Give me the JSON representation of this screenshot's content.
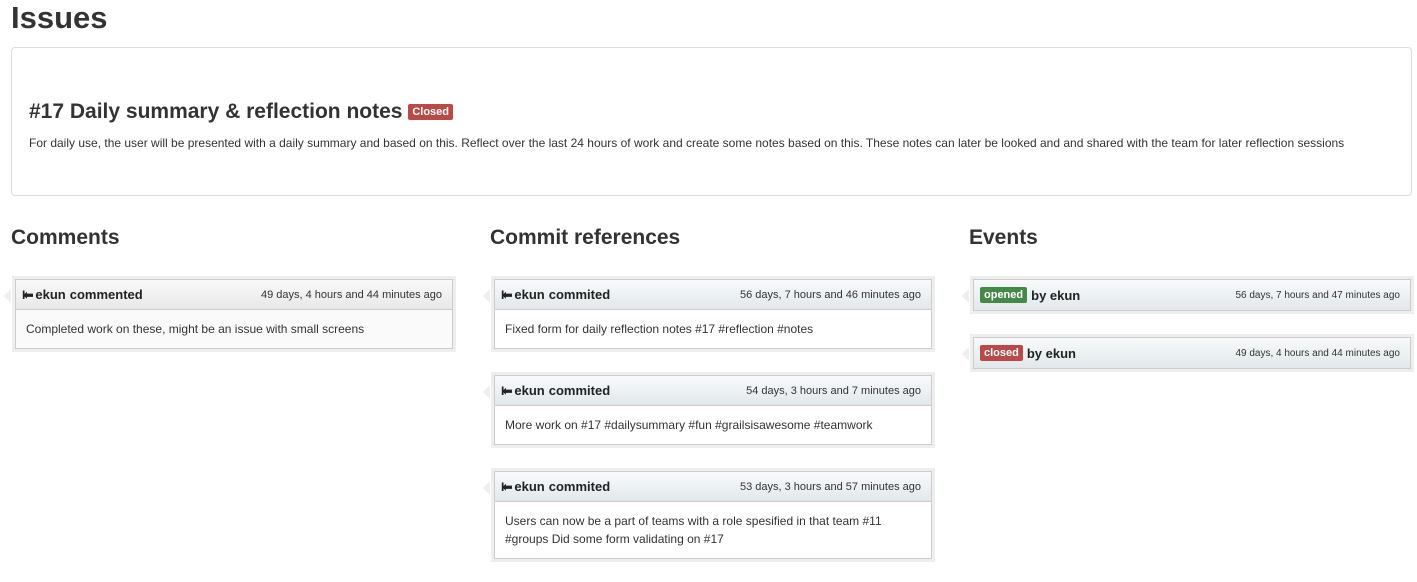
{
  "page": {
    "title": "Issues"
  },
  "issue": {
    "title": "#17 Daily summary & reflection notes",
    "status": "Closed",
    "description": "For daily use, the user will be presented with a daily summary and based on this. Reflect over the last 24 hours of work and create some notes based on this. These notes can later be looked and and shared with the team for later reflection sessions"
  },
  "comments": {
    "heading": "Comments",
    "items": [
      {
        "author": "ekun",
        "action": "commented",
        "time": "49 days, 4 hours and 44 minutes ago",
        "text": "Completed work on these, might be an issue with small screens"
      }
    ]
  },
  "commits": {
    "heading": "Commit references",
    "items": [
      {
        "author": "ekun",
        "action": "commited",
        "time": "56 days, 7 hours and 46 minutes ago",
        "text": "Fixed form for daily reflection notes #17 #reflection #notes"
      },
      {
        "author": "ekun",
        "action": "commited",
        "time": "54 days, 3 hours and 7 minutes ago",
        "text": "More work on #17 #dailysummary #fun #grailsisawesome #teamwork"
      },
      {
        "author": "ekun",
        "action": "commited",
        "time": "53 days, 3 hours and 57 minutes ago",
        "text": "Users can now be a part of teams with a role spesified in that team #11 #groups Did some form validating on #17"
      }
    ]
  },
  "events": {
    "heading": "Events",
    "items": [
      {
        "type": "opened",
        "by": "by ekun",
        "time": "56 days, 7 hours and 47 minutes ago",
        "color": "#468847"
      },
      {
        "type": "closed",
        "by": "by ekun",
        "time": "49 days, 4 hours and 44 minutes ago",
        "color": "#b94a48"
      }
    ]
  },
  "colors": {
    "closed": "#b94a48",
    "opened": "#468847"
  }
}
